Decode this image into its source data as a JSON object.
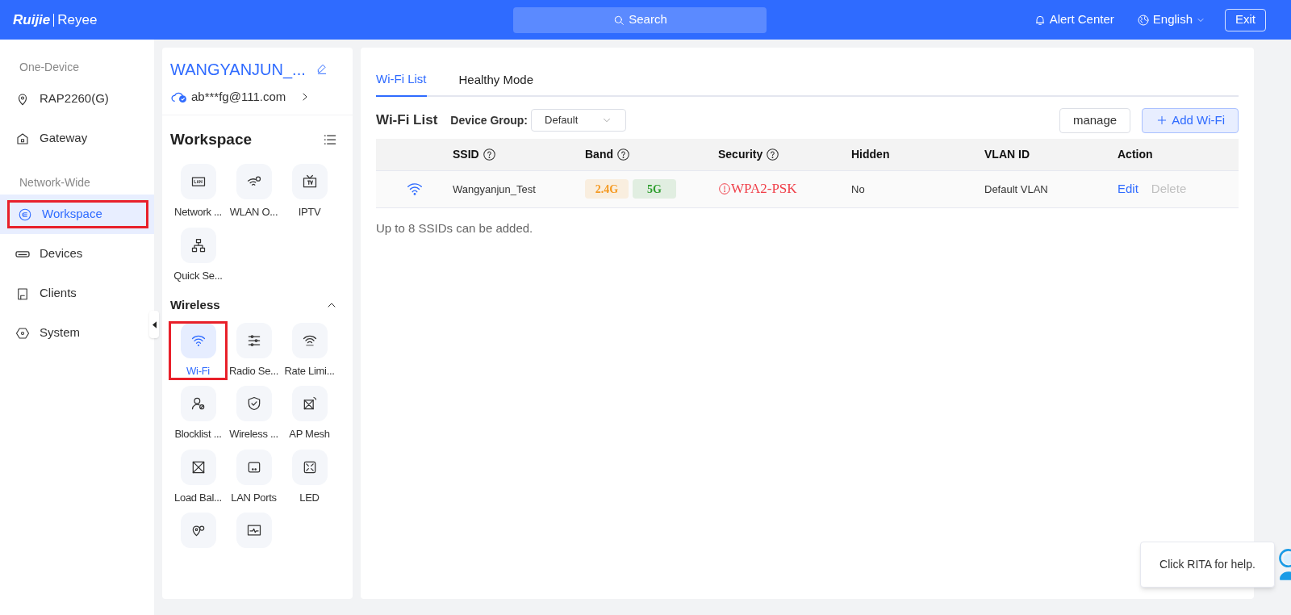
{
  "header": {
    "logo_left": "Ruijie",
    "logo_right": "Reyee",
    "search": "Search",
    "alert": "Alert Center",
    "language": "English",
    "exit": "Exit"
  },
  "nav": [
    {
      "kind": "heading",
      "label": "One-Device"
    },
    {
      "kind": "item",
      "label": "RAP2260(G)",
      "selected": false,
      "highlighted": false
    },
    {
      "kind": "item",
      "label": "Gateway",
      "selected": false,
      "highlighted": false
    },
    {
      "kind": "heading",
      "label": "Network-Wide"
    },
    {
      "kind": "item",
      "label": "Workspace",
      "selected": true,
      "highlighted": true
    },
    {
      "kind": "item",
      "label": "Devices",
      "selected": false,
      "highlighted": false
    },
    {
      "kind": "item",
      "label": "Clients",
      "selected": false,
      "highlighted": false
    },
    {
      "kind": "item",
      "label": "System",
      "selected": false,
      "highlighted": false
    }
  ],
  "account": {
    "network_name": "WANGYANJUN_...",
    "email": "ab***fg@111.com"
  },
  "workspace": {
    "title": "Workspace",
    "groups": [
      {
        "tiles": [
          {
            "label": "Network ...",
            "selected": false,
            "highlighted": false
          },
          {
            "label": "WLAN O...",
            "selected": false,
            "highlighted": false
          },
          {
            "label": "IPTV",
            "selected": false,
            "highlighted": false
          },
          {
            "label": "Quick Se...",
            "selected": false,
            "highlighted": false
          }
        ]
      },
      {
        "title": "Wireless",
        "expanded": true,
        "tiles": [
          {
            "label": "Wi-Fi",
            "selected": true,
            "highlighted": true
          },
          {
            "label": "Radio Se...",
            "selected": false,
            "highlighted": false
          },
          {
            "label": "Rate Limi...",
            "selected": false,
            "highlighted": false
          },
          {
            "label": "Blocklist ...",
            "selected": false,
            "highlighted": false
          },
          {
            "label": "Wireless ...",
            "selected": false,
            "highlighted": false
          },
          {
            "label": "AP Mesh",
            "selected": false,
            "highlighted": false
          },
          {
            "label": "Load Bal...",
            "selected": false,
            "highlighted": false
          },
          {
            "label": "LAN Ports",
            "selected": false,
            "highlighted": false
          },
          {
            "label": "LED",
            "selected": false,
            "highlighted": false
          },
          {
            "selected": false,
            "highlighted": false
          },
          {
            "selected": false,
            "highlighted": false
          }
        ]
      }
    ]
  },
  "tabs": [
    {
      "label": "Wi-Fi List",
      "selected": true
    },
    {
      "label": "Healthy Mode",
      "selected": false
    }
  ],
  "wifi_list": {
    "title": "Wi-Fi List",
    "group_label": "Device Group:",
    "group_value": "Default",
    "manage": "manage",
    "add": "Add Wi-Fi",
    "columns": [
      {
        "label": "SSID",
        "kind": "help"
      },
      {
        "label": "Band",
        "kind": "help"
      },
      {
        "label": "Security",
        "kind": "help"
      },
      {
        "label": "Hidden",
        "kind": "plain"
      },
      {
        "label": "VLAN ID",
        "kind": "plain"
      },
      {
        "label": "Action",
        "kind": "plain"
      }
    ],
    "rows": [
      {
        "ssid": "Wangyanjun_Test",
        "bands": [
          {
            "label": "2.4G",
            "color": "#f59a23"
          },
          {
            "label": "5G",
            "color": "#2e9e2e"
          }
        ],
        "security": "WPA2-PSK",
        "security_warning": true,
        "hidden": "No",
        "vlan": "Default VLAN",
        "edit": "Edit",
        "delete": "Delete",
        "delete_disabled": true
      }
    ],
    "note": "Up to 8 SSIDs can be added."
  },
  "help_tip": "Click RITA for help."
}
